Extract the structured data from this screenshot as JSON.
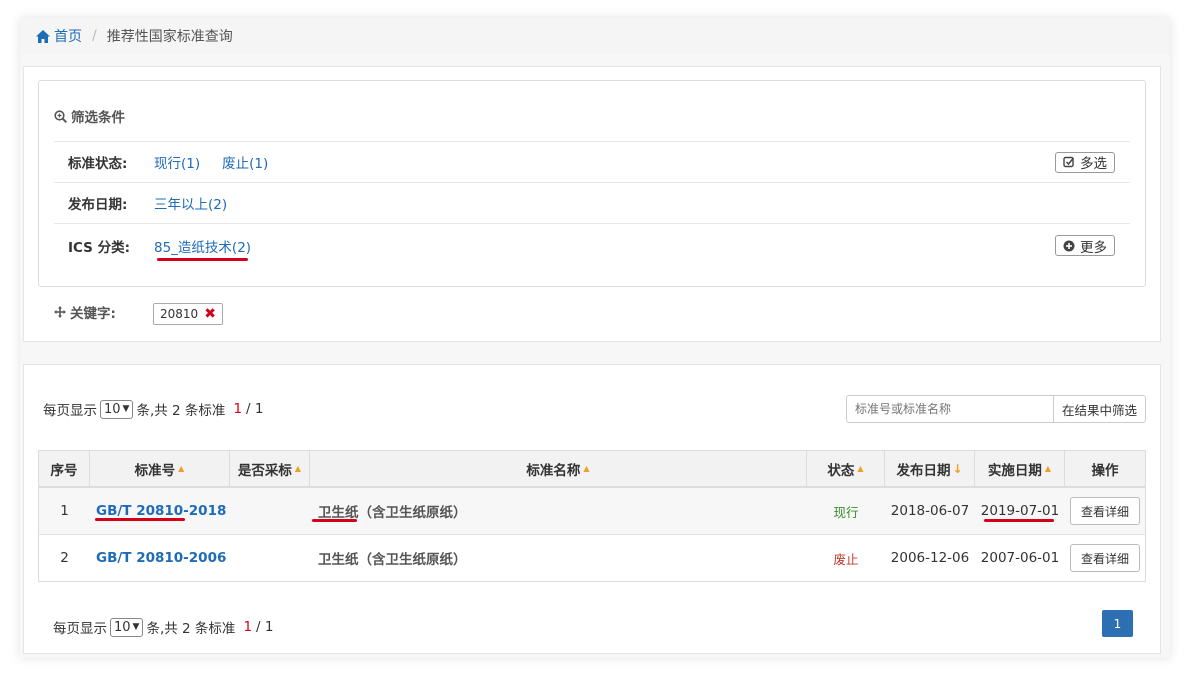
{
  "breadcrumb": {
    "home": "首页",
    "separator": "/",
    "current": "推荐性国家标准查询"
  },
  "filter": {
    "title": "筛选条件",
    "rows": [
      {
        "label": "标准状态:",
        "options": [
          "现行(1)",
          "废止(1)"
        ],
        "button": "多选"
      },
      {
        "label": "发布日期:",
        "options": [
          "三年以上(2)"
        ]
      },
      {
        "label": "ICS 分类:",
        "options": [
          "85_造纸技术(2)"
        ],
        "button": "更多"
      }
    ],
    "keyword_label": "关键字:",
    "keyword_value": "20810",
    "keyword_remove": "✖"
  },
  "pager": {
    "prefix": "每页显示",
    "per_page": "10",
    "suffix": "条,共 2 条标准",
    "current_page": "1",
    "total_pages": "/ 1"
  },
  "search": {
    "placeholder": "标准号或标准名称",
    "button": "在结果中筛选"
  },
  "table": {
    "headers": [
      "序号",
      "标准号",
      "是否采标",
      "标准名称",
      "状态",
      "发布日期",
      "实施日期",
      "操作"
    ],
    "rows": [
      {
        "index": "1",
        "std_no": "GB/T 20810-2018",
        "adopted": "",
        "name": "卫生纸（含卫生纸原纸）",
        "status": "现行",
        "publish": "2018-06-07",
        "implement": "2019-07-01",
        "action": "查看详细"
      },
      {
        "index": "2",
        "std_no": "GB/T 20810-2006",
        "adopted": "",
        "name": "卫生纸（含卫生纸原纸）",
        "status": "废止",
        "publish": "2006-12-06",
        "implement": "2007-06-01",
        "action": "查看详细"
      }
    ]
  },
  "pagination": {
    "page": "1"
  },
  "colors": {
    "link": "#1e6bb8",
    "accent_red": "#d4001a",
    "status_on": "#3a8a2c",
    "status_off": "#c0392b",
    "sort": "#f0a020",
    "page_active": "#2c6fb3"
  }
}
